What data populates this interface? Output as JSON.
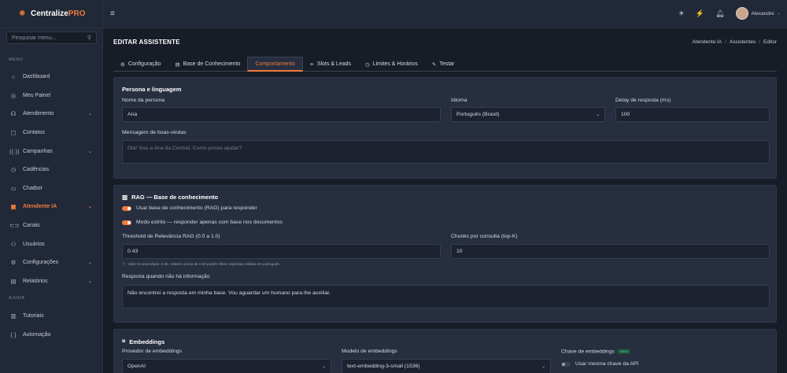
{
  "brand": {
    "name_main": "Centralize",
    "name_accent": "PRO",
    "accent_color": "#f07b3f",
    "logo_icon": "sun-logo-icon"
  },
  "sidebar": {
    "search_placeholder": "Pesquisar menu...",
    "menu_label": "MENU",
    "help_label": "AJUDA",
    "items": [
      {
        "label": "Dashboard",
        "icon": "home-icon"
      },
      {
        "label": "Meu Painel",
        "icon": "user-circle-icon"
      },
      {
        "label": "Atendimento",
        "icon": "headset-icon",
        "expandable": true
      },
      {
        "label": "Contatos",
        "icon": "contacts-icon"
      },
      {
        "label": "Campanhas",
        "icon": "broadcast-icon",
        "expandable": true
      },
      {
        "label": "Cadências",
        "icon": "clock-icon"
      },
      {
        "label": "Chatbot",
        "icon": "chat-icon"
      },
      {
        "label": "Atendente IA",
        "icon": "robot-icon",
        "expandable": true,
        "active": true
      },
      {
        "label": "Canais",
        "icon": "link-icon"
      },
      {
        "label": "Usuários",
        "icon": "users-icon"
      },
      {
        "label": "Configurações",
        "icon": "gear-icon",
        "expandable": true
      },
      {
        "label": "Relatórios",
        "icon": "chart-icon",
        "expandable": true
      }
    ],
    "help_items": [
      {
        "label": "Tutoriais",
        "icon": "book-icon"
      },
      {
        "label": "Automação",
        "icon": "code-icon"
      }
    ]
  },
  "topbar": {
    "user_name": "Alexandre"
  },
  "page": {
    "title": "EDITAR ASSISTENTE",
    "breadcrumb": [
      "Atendente IA",
      "Assistentes",
      "Editor"
    ],
    "tabs": [
      "Configuração",
      "Base de Conhecimento",
      "Comportamento",
      "Slots & Leads",
      "Limites & Horários",
      "Testar"
    ],
    "active_tab": "Comportamento"
  },
  "persona": {
    "title": "Persona e linguagem",
    "name_label": "Nome da persona",
    "name_value": "Ana",
    "lang_label": "Idioma",
    "lang_value": "Português (Brasil)",
    "delay_label": "Delay de resposta (ms)",
    "delay_value": "100",
    "welcome_label": "Mensagem de boas-vindas",
    "welcome_placeholder": "Olá! Sou a Ana da Central. Como posso ajudar?"
  },
  "rag": {
    "title": "RAG — Base de conhecimento",
    "toggle1": "Usar base de conhecimento (RAG) para responder",
    "toggle2": "Modo estrito — responder apenas com base nos documentos",
    "threshold_label": "Threshold de Relevância RAG (0.0 a 1.0)",
    "threshold_value": "0.43",
    "chunks_label": "Chunks por consulta (top-K)",
    "chunks_value": "10",
    "hint": "Valor recomendado: 0.45. Valores acima de 0.50 podem filtrar respostas válidas em português.",
    "fallback_label": "Resposta quando não há informação",
    "fallback_value": "Não encontrei a resposta em minha base. Vou aguardar um humano para lhe auxiliar."
  },
  "embeddings": {
    "title": "Embeddings",
    "provider_label": "Provedor de embeddings",
    "provider_value": "OpenAI",
    "model_label": "Modelo de embeddings",
    "model_value": "text-embedding-3-small (1536)",
    "key_label": "Chave de embeddings",
    "key_badge": "Salva",
    "key_toggle": "Usar mesma chave da API"
  }
}
